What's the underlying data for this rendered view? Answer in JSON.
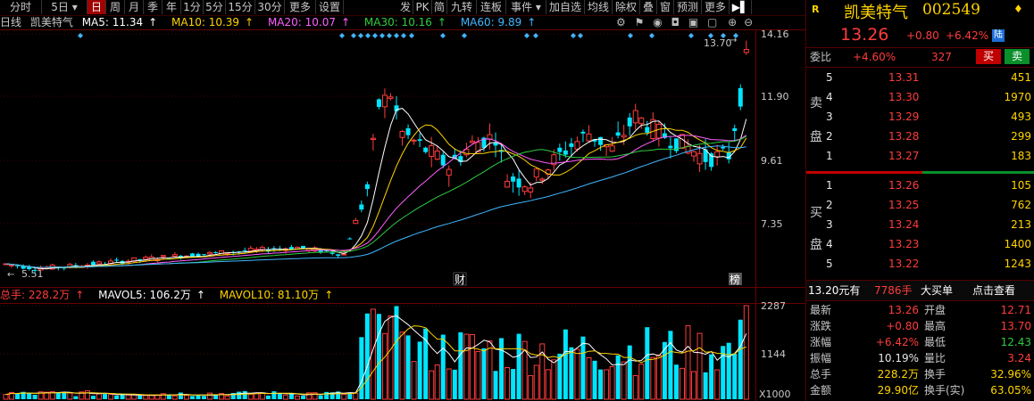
{
  "toolbar": {
    "left_tabs": [
      "分时",
      "5日",
      "日",
      "周",
      "月",
      "季",
      "年",
      "1分",
      "5分",
      "15分",
      "30分",
      "更多",
      "设置"
    ],
    "active_tab": "日",
    "right_tabs": [
      "发",
      "PK",
      "简",
      "九转",
      "连板",
      "事件",
      "加自选",
      "均线",
      "除权",
      "叠",
      "窗",
      "预测",
      "更多"
    ]
  },
  "indicators": {
    "period_label": "日线",
    "stock_name": "凯美特气",
    "ma5": "MA5: 11.34",
    "ma10": "MA10: 10.39",
    "ma20": "MA20: 10.07",
    "ma30": "MA30: 10.16",
    "ma60": "MA60: 9.89",
    "arrow": "↑"
  },
  "price_axis": {
    "ticks": [
      "14.16",
      "11.90",
      "9.61",
      "7.35"
    ],
    "high_label": "13.70",
    "low_label": "5.51"
  },
  "markers": {
    "cai": "财",
    "bang": "榜"
  },
  "volume_info": {
    "total": "总手: 228.2万",
    "mavol5": "MAVOL5: 106.2万",
    "mavol10": "MAVOL10: 81.10万",
    "arrow": "↑",
    "ticks": [
      "2287",
      "1144"
    ],
    "unit": "X1000"
  },
  "quote": {
    "badge": "R",
    "name": "凯美特气",
    "code": "002549",
    "price": "13.26",
    "change": "+0.80",
    "change_pct": "+6.42%",
    "board_tag": "陆",
    "weibi_label": "委比",
    "weibi_value": "+4.60%",
    "weibi_diff": "327",
    "buy_btn": "买",
    "sell_btn": "卖",
    "sell_side_label": [
      "卖",
      "盘"
    ],
    "buy_side_label": [
      "买",
      "盘"
    ],
    "asks": [
      {
        "level": "5",
        "price": "13.31",
        "vol": "451"
      },
      {
        "level": "4",
        "price": "13.30",
        "vol": "1970"
      },
      {
        "level": "3",
        "price": "13.29",
        "vol": "493"
      },
      {
        "level": "2",
        "price": "13.28",
        "vol": "299"
      },
      {
        "level": "1",
        "price": "13.27",
        "vol": "183"
      }
    ],
    "bids": [
      {
        "level": "1",
        "price": "13.26",
        "vol": "105"
      },
      {
        "level": "2",
        "price": "13.25",
        "vol": "762"
      },
      {
        "level": "3",
        "price": "13.24",
        "vol": "213"
      },
      {
        "level": "4",
        "price": "13.23",
        "vol": "1400"
      },
      {
        "level": "5",
        "price": "13.22",
        "vol": "1243"
      }
    ],
    "big_order": {
      "price": "13.20元有",
      "qty": "7786手",
      "label": "大买单",
      "link": "点击查看"
    },
    "stats": [
      {
        "l1": "最新",
        "v1": "13.26",
        "c1": "red",
        "l2": "开盘",
        "v2": "12.71",
        "c2": "red"
      },
      {
        "l1": "涨跌",
        "v1": "+0.80",
        "c1": "red",
        "l2": "最高",
        "v2": "13.70",
        "c2": "red"
      },
      {
        "l1": "涨幅",
        "v1": "+6.42%",
        "c1": "red",
        "l2": "最低",
        "v2": "12.43",
        "c2": "green"
      },
      {
        "l1": "振幅",
        "v1": "10.19%",
        "c1": "white",
        "l2": "量比",
        "v2": "3.24",
        "c2": "red"
      },
      {
        "l1": "总手",
        "v1": "228.2万",
        "c1": "yellow",
        "l2": "换手",
        "v2": "32.96%",
        "c2": "yellow"
      },
      {
        "l1": "金额",
        "v1": "29.90亿",
        "c1": "yellow",
        "l2": "换手(实)",
        "v2": "63.05%",
        "c2": "yellow"
      }
    ]
  },
  "colors": {
    "up": "#ff3c3c",
    "down": "#00e5ff",
    "ma5": "#ffffff",
    "ma10": "#ffd400",
    "ma20": "#ff5fff",
    "ma30": "#2ecc40",
    "ma60": "#3fb6ff"
  }
}
